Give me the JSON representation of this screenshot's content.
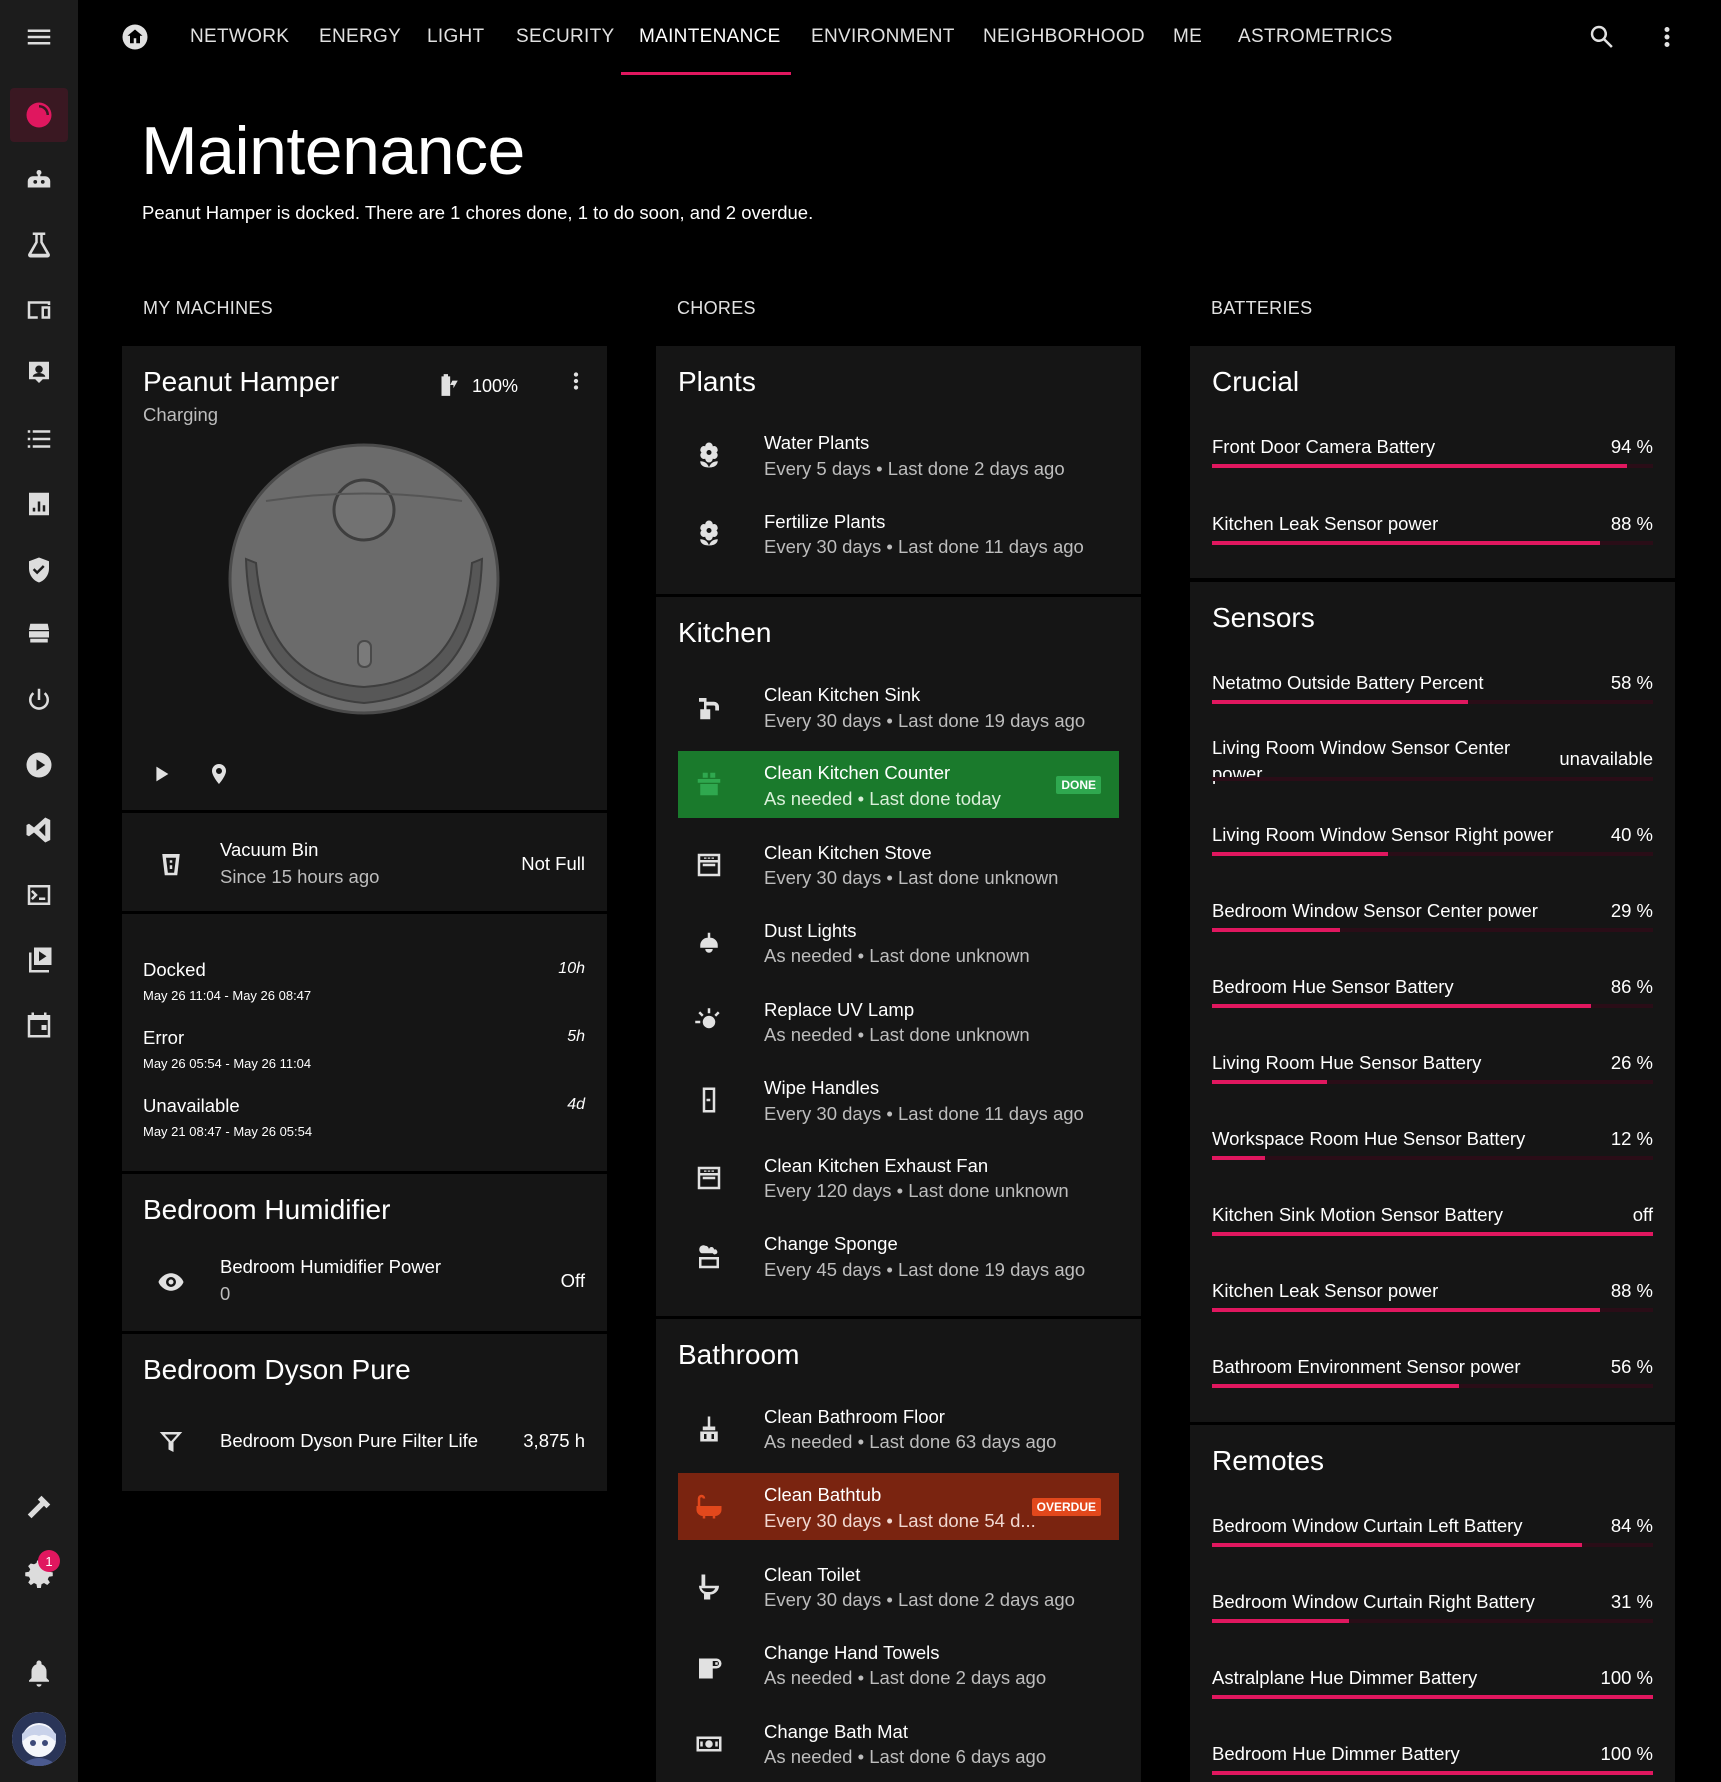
{
  "nav": {
    "tabs": [
      {
        "label": "NETWORK"
      },
      {
        "label": "ENERGY"
      },
      {
        "label": "LIGHT"
      },
      {
        "label": "SECURITY"
      },
      {
        "label": "MAINTENANCE"
      },
      {
        "label": "ENVIRONMENT"
      },
      {
        "label": "NEIGHBORHOOD"
      },
      {
        "label": "ME"
      },
      {
        "label": "ASTROMETRICS"
      }
    ],
    "active_tab": "MAINTENANCE"
  },
  "sidebar": {
    "icons": [
      "menu-icon",
      "dashboard-icon",
      "robot-icon",
      "flask-icon",
      "devices-icon",
      "account-box-icon",
      "list-icon",
      "chart-icon",
      "shield-check-icon",
      "hacs-icon",
      "power-icon",
      "play-icon",
      "vscode-icon",
      "terminal-icon",
      "media-icon",
      "calendar-icon",
      "hammer-icon",
      "settings-icon",
      "bell-icon"
    ],
    "notification_count": "1"
  },
  "page": {
    "title": "Maintenance",
    "subtitle": "Peanut Hamper is docked. There are 1 chores done, 1 to do soon, and 2 overdue."
  },
  "columns": {
    "machines": "MY MACHINES",
    "chores": "CHORES",
    "batteries": "BATTERIES"
  },
  "vacuum": {
    "name": "Peanut Hamper",
    "status": "Charging",
    "battery": "100%",
    "bin_label": "Vacuum Bin",
    "bin_since": "Since 15 hours ago",
    "bin_value": "Not Full",
    "history": [
      {
        "state": "Docked",
        "range": "May 26 11:04 - May 26 08:47",
        "duration": "10h"
      },
      {
        "state": "Error",
        "range": "May 26 05:54 - May 26 11:04",
        "duration": "5h"
      },
      {
        "state": "Unavailable",
        "range": "May 21 08:47 - May 26 05:54",
        "duration": "4d"
      }
    ]
  },
  "humidifier": {
    "title": "Bedroom Humidifier",
    "label": "Bedroom Humidifier Power",
    "sub": "0",
    "value": "Off"
  },
  "dyson": {
    "title": "Bedroom Dyson Pure",
    "label": "Bedroom Dyson Pure Filter Life",
    "value": "3,875 h"
  },
  "chores": {
    "plants": {
      "title": "Plants",
      "items": [
        {
          "name": "Water Plants",
          "detail": "Every 5 days • Last done 2 days ago"
        },
        {
          "name": "Fertilize Plants",
          "detail": "Every 30 days • Last done 11 days ago"
        }
      ]
    },
    "kitchen": {
      "title": "Kitchen",
      "items": [
        {
          "name": "Clean Kitchen Sink",
          "detail": "Every 30 days • Last done 19 days ago"
        },
        {
          "name": "Clean Kitchen Counter",
          "detail": "As needed • Last done today",
          "tag": "DONE"
        },
        {
          "name": "Clean Kitchen Stove",
          "detail": "Every 30 days • Last done unknown"
        },
        {
          "name": "Dust Lights",
          "detail": "As needed • Last done unknown"
        },
        {
          "name": "Replace UV Lamp",
          "detail": "As needed • Last done unknown"
        },
        {
          "name": "Wipe Handles",
          "detail": "Every 30 days • Last done 11 days ago"
        },
        {
          "name": "Clean Kitchen Exhaust Fan",
          "detail": "Every 120 days • Last done unknown"
        },
        {
          "name": "Change Sponge",
          "detail": "Every 45 days • Last done 19 days ago"
        }
      ]
    },
    "bathroom": {
      "title": "Bathroom",
      "items": [
        {
          "name": "Clean Bathroom Floor",
          "detail": "As needed • Last done 63 days ago"
        },
        {
          "name": "Clean Bathtub",
          "detail": "Every 30 days • Last done 54 d...",
          "tag": "OVERDUE"
        },
        {
          "name": "Clean Toilet",
          "detail": "Every 30 days • Last done 2 days ago"
        },
        {
          "name": "Change Hand Towels",
          "detail": "As needed • Last done 2 days ago"
        },
        {
          "name": "Change Bath Mat",
          "detail": "As needed • Last done 6 days ago"
        }
      ]
    }
  },
  "batteries": {
    "crucial": {
      "title": "Crucial",
      "items": [
        {
          "name": "Front Door Camera Battery",
          "value": "94 %",
          "level": 94
        },
        {
          "name": "Kitchen Leak Sensor power",
          "value": "88 %",
          "level": 88
        }
      ]
    },
    "sensors": {
      "title": "Sensors",
      "items": [
        {
          "name": "Netatmo Outside Battery Percent",
          "value": "58 %",
          "level": 58
        },
        {
          "name": "Living Room Window Sensor Center power",
          "value": "unavailable",
          "level": 0
        },
        {
          "name": "Living Room Window Sensor Right power",
          "value": "40 %",
          "level": 40
        },
        {
          "name": "Bedroom Window Sensor Center power",
          "value": "29 %",
          "level": 29
        },
        {
          "name": "Bedroom Hue Sensor Battery",
          "value": "86 %",
          "level": 86
        },
        {
          "name": "Living Room Hue Sensor Battery",
          "value": "26 %",
          "level": 26
        },
        {
          "name": "Workspace Room Hue Sensor Battery",
          "value": "12 %",
          "level": 12
        },
        {
          "name": "Kitchen Sink Motion Sensor Battery",
          "value": "off",
          "level": 100
        },
        {
          "name": "Kitchen Leak Sensor power",
          "value": "88 %",
          "level": 88
        },
        {
          "name": "Bathroom Environment Sensor power",
          "value": "56 %",
          "level": 56
        }
      ]
    },
    "remotes": {
      "title": "Remotes",
      "items": [
        {
          "name": "Bedroom Window Curtain Left Battery",
          "value": "84 %",
          "level": 84
        },
        {
          "name": "Bedroom Window Curtain Right Battery",
          "value": "31 %",
          "level": 31
        },
        {
          "name": "Astralplane Hue Dimmer Battery",
          "value": "100 %",
          "level": 100
        },
        {
          "name": "Bedroom Hue Dimmer Battery",
          "value": "100 %",
          "level": 100
        }
      ]
    }
  },
  "colors": {
    "accent": "#e0175f",
    "done": "#1a7a2c",
    "overdue": "#7a2410",
    "done_tag": "#2fa84f",
    "overdue_tag": "#e2481c"
  }
}
